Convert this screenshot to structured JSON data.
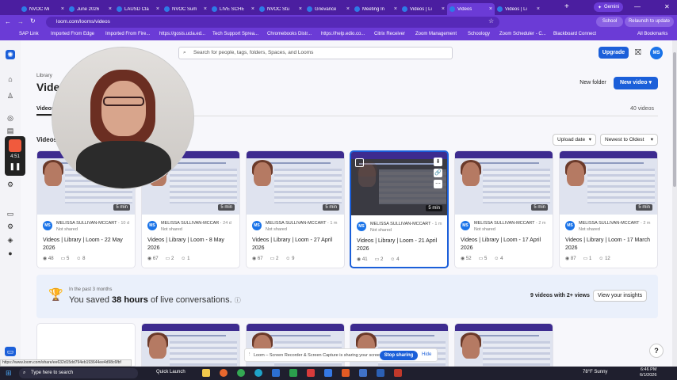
{
  "browser": {
    "tabs": [
      {
        "title": "NVOC Mi",
        "active": false
      },
      {
        "title": "June 2026",
        "active": false
      },
      {
        "title": "LAUSD Cla",
        "active": false
      },
      {
        "title": "NVOC Sum",
        "active": false
      },
      {
        "title": "LIVE SCHE",
        "active": false
      },
      {
        "title": "NVOC Stu",
        "active": false
      },
      {
        "title": "Grievance",
        "active": false
      },
      {
        "title": "Meeting In",
        "active": false
      },
      {
        "title": "Videos | Li",
        "active": false
      },
      {
        "title": "Videos",
        "active": true
      },
      {
        "title": "Videos | Li",
        "active": false
      }
    ],
    "gemini_label": "Gemini",
    "url": "loom.com/looms/videos",
    "profile_label": "School",
    "relaunch_label": "Relaunch to update",
    "bookmarks": [
      "SAP Link",
      "Imported From Edge",
      "Imported From Fire...",
      "https://gosis.ucla.ed...",
      "Tech Support Sprea...",
      "Chromebooks Distr...",
      "https://help.edio.co...",
      "Citrix Receiver",
      "Zoom Management",
      "Schoology",
      "Zoom Scheduler - C...",
      "Blackboard Connect",
      "All Bookmarks"
    ]
  },
  "header": {
    "search_placeholder": "Search for people, tags, folders, Spaces, and Looms",
    "upgrade_label": "Upgrade",
    "avatar_initials": "MS"
  },
  "recorder": {
    "time": "4:51"
  },
  "library": {
    "breadcrumb": "Library",
    "title": "Videos",
    "new_folder_label": "New folder",
    "new_video_label": "New video",
    "tab_videos": "Videos",
    "video_count": "40 videos",
    "section_title": "Videos",
    "sort_upload": "Upload date",
    "sort_order": "Newest to Oldest"
  },
  "videos": [
    {
      "author": "MELISSA SULLIVAN-MCCART",
      "ago": "10 d",
      "shared": "Not shared",
      "title": "Videos | Library | Loom - 22 May 2026",
      "views": "48",
      "comments": "5",
      "reactions": "8",
      "duration": "5 min"
    },
    {
      "author": "MELISSA SULLIVAN-MCCAR",
      "ago": "24 d",
      "shared": "Not shared",
      "title": "Videos | Library | Loom - 8 May 2026",
      "views": "67",
      "comments": "2",
      "reactions": "1",
      "duration": "5 min"
    },
    {
      "author": "MELISSA SULLIVAN-MCCART",
      "ago": "1 m",
      "shared": "Not shared",
      "title": "Videos | Library | Loom - 27 April 2026",
      "views": "67",
      "comments": "2",
      "reactions": "9",
      "duration": "5 min"
    },
    {
      "author": "MELISSA SULLIVAN-MCCART",
      "ago": "1 m",
      "shared": "Not shared",
      "title": "Videos | Library | Loom - 21 April 2026",
      "views": "41",
      "comments": "2",
      "reactions": "4",
      "duration": "5 min"
    },
    {
      "author": "MELISSA SULLIVAN-MCCART",
      "ago": "2 m",
      "shared": "Not shared",
      "title": "Videos | Library | Loom - 17 April 2026",
      "views": "52",
      "comments": "5",
      "reactions": "4",
      "duration": "5 min"
    },
    {
      "author": "MELISSA SULLIVAN-MCCART",
      "ago": "2 m",
      "shared": "Not shared",
      "title": "Videos | Library | Loom - 17 March 2026",
      "views": "87",
      "comments": "1",
      "reactions": "12",
      "duration": "5 min"
    }
  ],
  "insights": {
    "period": "In the past 3 months",
    "saved_prefix": "You saved ",
    "saved_hours": "38 hours",
    "saved_suffix": " of live conversations.",
    "videos_with_views": "9 videos with 2+ views",
    "button_label": "View your insights"
  },
  "sharing_bar": {
    "message": "Loom – Screen Recorder & Screen Capture is sharing your screen.",
    "stop_label": "Stop sharing",
    "hide_label": "Hide"
  },
  "status_url": "https://www.loom.com/share/ee632d15dd794eb193644ee4d98c6fbf",
  "taskbar": {
    "search_placeholder": "Type here to search",
    "quick_launch": "Quick Launch",
    "weather": "78°F Sunny",
    "time": "6:46 PM",
    "date": "6/1/2026"
  }
}
